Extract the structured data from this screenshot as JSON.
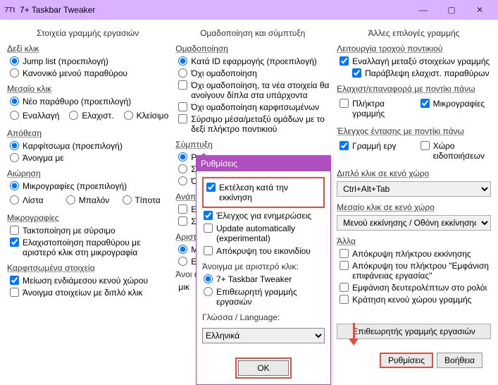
{
  "title": "7+ Taskbar Tweaker",
  "window_controls": {
    "minimize": "—",
    "maximize": "▢",
    "close": "✕"
  },
  "columns": {
    "left": {
      "title": "Στοιχεία γραμμής εργασιών",
      "groups": {
        "rightclick": {
          "label": "Δεξί κλικ",
          "opts": [
            "Jump list (προεπιλογή)",
            "Κανονικό μενού παραθύρου"
          ]
        },
        "middleclick": {
          "label": "Μεσαίο κλικ",
          "row1": "Νέο παράθυρο (προεπιλογή)",
          "opts": [
            "Εναλλαγή",
            "Ελαχιστ.",
            "Κλείσιμο"
          ]
        },
        "drop": {
          "label": "Απόθεση",
          "opts": [
            "Καρφίτσωμα (προεπιλογή)",
            "Άνοιγμα με"
          ]
        },
        "hover": {
          "label": "Αιώρηση",
          "row1": "Μικρογραφίες (προεπιλογή)",
          "opts": [
            "Λίστα",
            "Μπαλόν",
            "Τίποτα"
          ]
        },
        "thumbs": {
          "label": "Μικρογραφίες",
          "opts": [
            "Τακτοποίηση με σύρσιμο",
            "Ελαχιστοποίηση παραθύρου με αριστερό κλικ στη μικρογραφία"
          ]
        },
        "pinned": {
          "label": "Καρφιτσωμένα στοιχεία",
          "opts": [
            "Μείωση ενδιάμεσου κενού χώρου",
            "Άνοιγμα στοιχείων με διπλό κλικ"
          ]
        }
      }
    },
    "middle": {
      "title": "Ομαδοποίηση και σύμπτυξη",
      "groups": {
        "grouping": {
          "label": "Ομαδοποίηση",
          "opts": [
            "Κατά ID εφαρμογής (προεπιλογή)",
            "Όχι ομαδοποίηση"
          ],
          "chk1": "Όχι ομαδοποίηση, τα νέα στοιχεία θα ανοίγουν δίπλα στα υπάρχοντα",
          "chk2": "Όχι ομαδοποίηση καρφιτσωμένων",
          "chk3": "Σύρσιμο μέσα/μεταξύ ομάδων με το δεξί πλήκτρο ποντικιού"
        },
        "combine": {
          "label": "Σύμπτυξη",
          "opts": [
            "Ρυθμ",
            "Σύμ",
            "Όχ"
          ]
        },
        "when": {
          "label": "Ανάπτ",
          "opts": [
            "Ενεργ",
            "Σε α"
          ]
        },
        "left": {
          "label": "Αριστερ",
          "opts": [
            "Μικ",
            "Ενα"
          ]
        },
        "other": {
          "label": "Άνοι είν",
          "opt": "μικ"
        }
      }
    },
    "right": {
      "title": "Άλλες επιλογές γραμμής",
      "groups": {
        "wheel": {
          "label": "Λειτουργία τροχού ποντικιού",
          "chk1": "Εναλλαγή μεταξύ στοιχείων γραμμής",
          "chk2": "Παράβλεψη ελαχιστ. παραθύρων"
        },
        "minmax": {
          "label": "Ελαχιστ/επαναφορά με ποντίκι πάνω",
          "opts": [
            "Πλήκτρα γραμμής",
            "Μικρογραφίες"
          ]
        },
        "volume": {
          "label": "Έλεγχος έντασης με ποντίκι πάνω",
          "opts": [
            "Γραμμή εργ",
            "Χώρο ειδοποιήσεων"
          ]
        },
        "double": {
          "label": "Διπλό κλικ σε κενό χώρο",
          "value": "Ctrl+Alt+Tab"
        },
        "middlee": {
          "label": "Μεσαίο κλικ σε κενό χώρο",
          "value": "Μενού εκκίνησης / Οθόνη εκκίνησης"
        },
        "other": {
          "label": "Άλλα",
          "opts": [
            "Απόκρυψη πλήκτρου εκκίνησης",
            "Απόκρυψη του πλήκτρου \"Εμφάνιση επιφάνειας εργασίας\"",
            "Εμφάνιση δευτερολέπτων στο ρολόι",
            "Κράτηση κενού χώρου γραμμής"
          ]
        },
        "inspector": "Επιθεωρητής γραμμής εργασιών"
      }
    }
  },
  "dialog": {
    "title": "Ρυθμίσεις",
    "chk_startup": "Εκτέλεση κατά την εκκίνηση",
    "chk_updates": "Έλεγχος για ενημερώσεις",
    "chk_auto": "Update automatically (experimental)",
    "chk_hide": "Απόκρυψη του εικονιδίου",
    "openleft": "Άνοιγμα με αριστερό κλικ:",
    "r1": "7+ Taskbar Tweaker",
    "r2": "Επιθεωρητή γραμμής εργασιών",
    "lang_label": "Γλώσσα / Language:",
    "lang_value": "Ελληνικά",
    "ok": "OK"
  },
  "bottom": {
    "settings": "Ρυθμίσεις",
    "help": "Βοήθεια"
  }
}
